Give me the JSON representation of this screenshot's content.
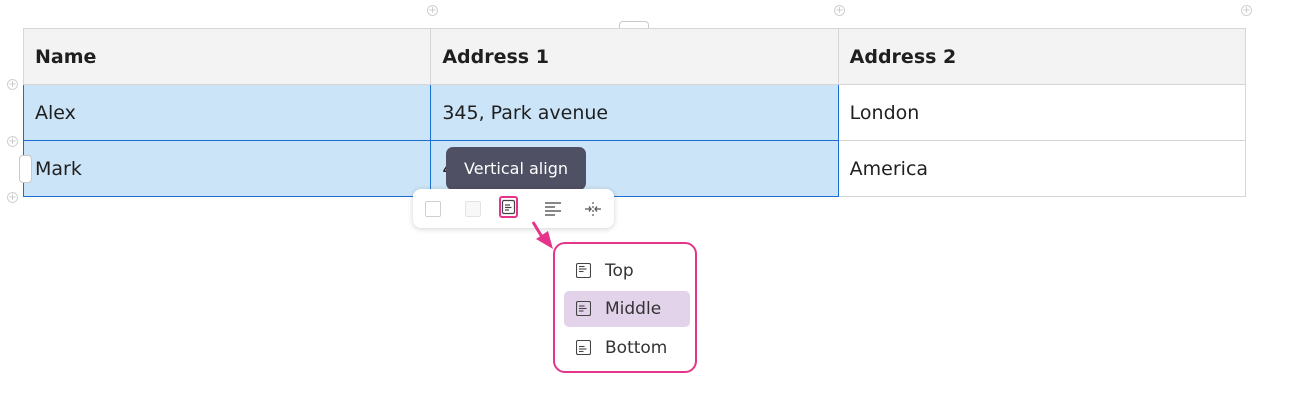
{
  "table": {
    "headers": [
      "Name",
      "Address 1",
      "Address 2"
    ],
    "rows": [
      [
        "Alex",
        "345, Park avenue",
        "London"
      ],
      [
        "Mark",
        "",
        "America"
      ]
    ],
    "partial_cell_text": "4"
  },
  "tooltip": {
    "text": "Vertical align"
  },
  "toolbar": {
    "buttons": [
      "checkbox-icon",
      "checkbox-disabled-icon",
      "vertical-align-icon",
      "text-align-left-icon",
      "collapse-horizontal-icon"
    ]
  },
  "vertical_align_menu": {
    "items": [
      "Top",
      "Middle",
      "Bottom"
    ],
    "selected": "Middle"
  },
  "colors": {
    "selection_fill": "#cce4f7",
    "selection_border": "#1a6fd1",
    "highlight_pink": "#e5358a",
    "tooltip_bg": "#4f5064",
    "menu_selected_bg": "#e2d3ea",
    "header_bg": "#f3f3f3"
  }
}
